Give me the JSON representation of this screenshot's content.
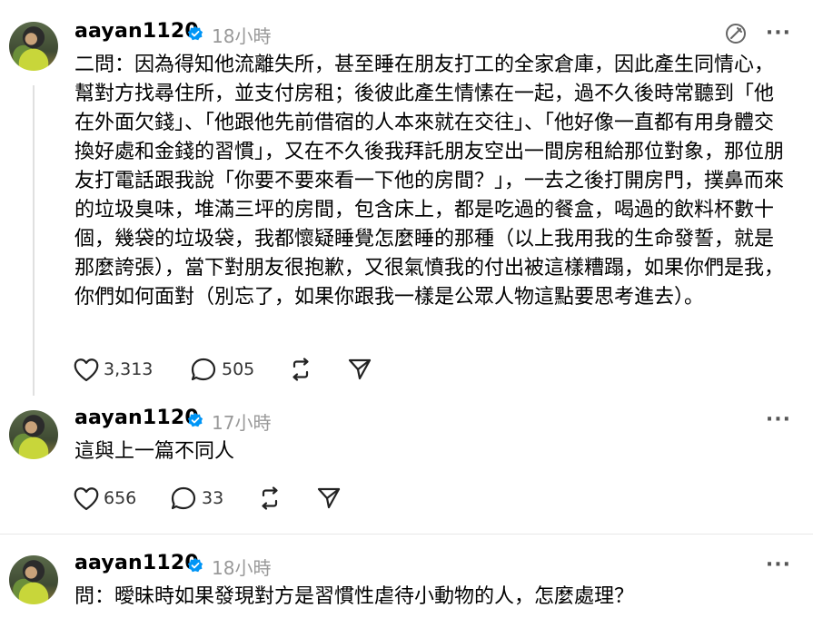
{
  "posts": [
    {
      "username": "aayan1120",
      "time": "18小時",
      "more": "···",
      "text": "二問：因為得知他流離失所，甚至睡在朋友打工的全家倉庫，因此產生同情心，幫對方找尋住所，並支付房租；後彼此產生情愫在一起，過不久後時常聽到「他在外面欠錢」、「他跟他先前借宿的人本來就在交往」、「他好像一直都有用身體交換好處和金錢的習慣」，又在不久後我拜託朋友空出一間房租給那位對象，那位朋友打電話跟我說「你要不要來看一下他的房間？」，一去之後打開房門，撲鼻而來的垃圾臭味，堆滿三坪的房間，包含床上，都是吃過的餐盒，喝過的飲料杯數十個，幾袋的垃圾袋，我都懷疑睡覺怎麼睡的那種（以上我用我的生命發誓，就是那麼誇張），當下對朋友很抱歉，又很氣憤我的付出被這樣糟蹋，如果你們是我，你們如何面對（別忘了，如果你跟我一樣是公眾人物這點要思考進去）。",
      "likes": "3,313",
      "replies": "505"
    },
    {
      "username": "aayan1120",
      "time": "17小時",
      "more": "···",
      "text": "這與上一篇不同人",
      "likes": "656",
      "replies": "33"
    },
    {
      "username": "aayan1120",
      "time": "18小時",
      "more": "···",
      "text": "問：曖昧時如果發現對方是習慣性虐待小動物的人，怎麼處理？"
    }
  ]
}
